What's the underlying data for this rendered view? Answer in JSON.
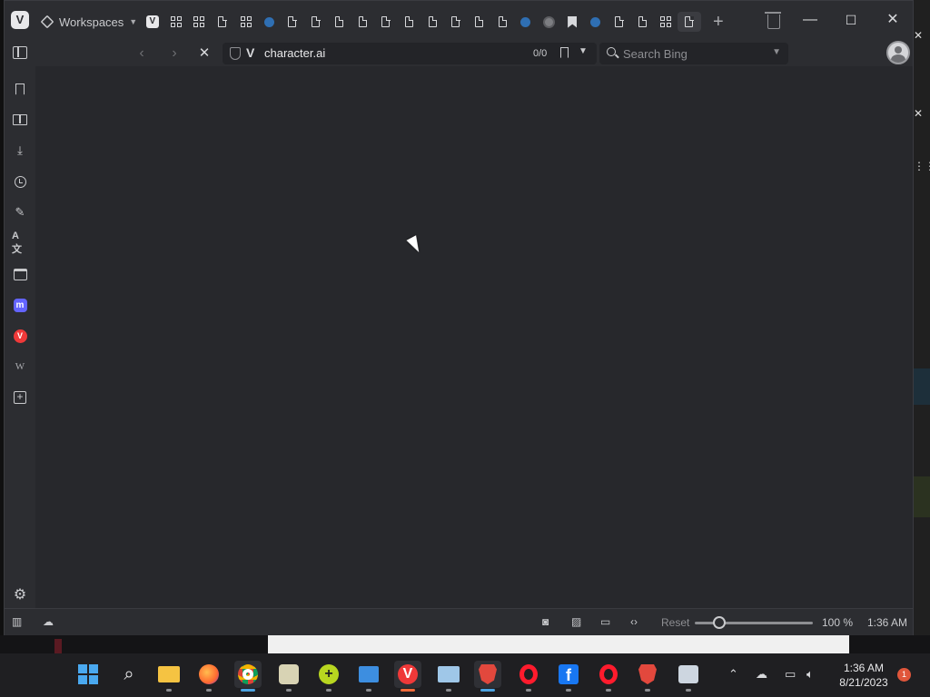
{
  "browser": {
    "workspaces_label": "Workspaces",
    "tabs": [
      "vivaldi",
      "grid",
      "grid",
      "doc",
      "grid",
      "blue",
      "doc",
      "doc",
      "doc",
      "doc",
      "doc",
      "doc",
      "doc",
      "doc",
      "doc",
      "doc",
      "blue",
      "globe",
      "bookmark",
      "blue",
      "doc",
      "doc",
      "grid",
      "doc-active"
    ]
  },
  "addressbar": {
    "url": "character.ai",
    "find_count": "0/0",
    "search_placeholder": "Search Bing"
  },
  "sidebar": {
    "items": [
      "bookmarks-icon",
      "reading-list-icon",
      "downloads-icon",
      "history-icon",
      "notes-icon",
      "translate-icon",
      "calendar-icon",
      "mastodon-icon",
      "vivaldi-icon",
      "wikipedia-icon",
      "add-panel-icon"
    ]
  },
  "statusbar": {
    "reset_label": "Reset",
    "zoom": "100 %",
    "zoom_fraction": 0.16,
    "clock": "1:36 AM"
  },
  "taskbar": {
    "time": "1:36 AM",
    "date": "8/21/2023",
    "notification_count": "1"
  },
  "colors": {
    "vivaldi_red": "#ef3939",
    "mastodon": "#6364ff",
    "windows_blue": "#4aa9f0"
  }
}
